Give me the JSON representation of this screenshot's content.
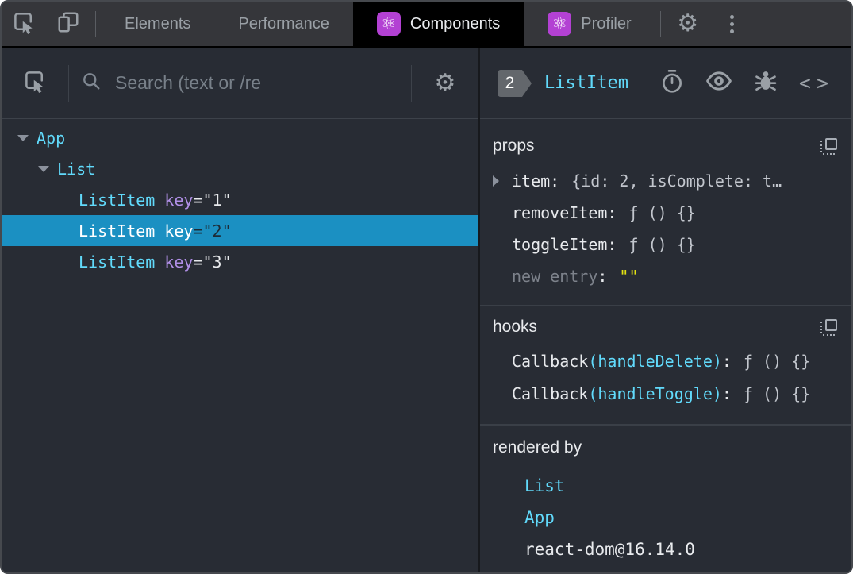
{
  "topbar": {
    "tabs": [
      {
        "label": "Elements",
        "active": false,
        "has_react_icon": false
      },
      {
        "label": "Performance",
        "active": false,
        "has_react_icon": false
      },
      {
        "label": "Components",
        "active": true,
        "has_react_icon": true
      },
      {
        "label": "Profiler",
        "active": false,
        "has_react_icon": true
      }
    ]
  },
  "icons": {
    "react_glyph": "⚛",
    "gear_glyph": "⚙",
    "code_glyph": "<>"
  },
  "glyphs": {
    "colon": ":"
  },
  "colors": {
    "accent_cyan": "#61dafb",
    "selected_row_blue": "#1b90c2",
    "react_purple": "#b341d3",
    "attr_purple": "#b08fe6",
    "string_yellow": "#e3e312",
    "panel_background": "#282c34",
    "topbar_background": "#35363a"
  },
  "left": {
    "search_placeholder": "Search (text or /re",
    "tree": [
      {
        "name": "App",
        "depth": 0,
        "expanded": true
      },
      {
        "name": "List",
        "depth": 1,
        "expanded": true
      },
      {
        "name": "ListItem",
        "attr_name": "key",
        "attr_value": "=\"1\"",
        "depth": 2,
        "selected": false
      },
      {
        "name": "ListItem",
        "attr_name": "key",
        "attr_value": "=\"2\"",
        "depth": 2,
        "selected": true
      },
      {
        "name": "ListItem",
        "attr_name": "key",
        "attr_value": "=\"3\"",
        "depth": 2,
        "selected": false
      }
    ]
  },
  "right": {
    "header": {
      "badge": "2",
      "component": "ListItem"
    },
    "props": {
      "title": "props",
      "rows": [
        {
          "key": "item",
          "value": "{id: 2, isComplete: t…",
          "expandable": true
        },
        {
          "key": "removeItem",
          "value": "ƒ () {}",
          "expandable": false
        },
        {
          "key": "toggleItem",
          "value": "ƒ () {}",
          "expandable": false
        },
        {
          "key": "new entry",
          "value": "\"\"",
          "expandable": false,
          "placeholder_row": true
        }
      ]
    },
    "hooks": {
      "title": "hooks",
      "rows": [
        {
          "name": "Callback",
          "fn": "(handleDelete)",
          "value": "ƒ () {}"
        },
        {
          "name": "Callback",
          "fn": "(handleToggle)",
          "value": "ƒ () {}"
        }
      ]
    },
    "rendered_by": {
      "title": "rendered by",
      "items": [
        {
          "label": "List",
          "link": true
        },
        {
          "label": "App",
          "link": true
        },
        {
          "label": "react-dom@16.14.0",
          "link": false
        }
      ]
    }
  }
}
